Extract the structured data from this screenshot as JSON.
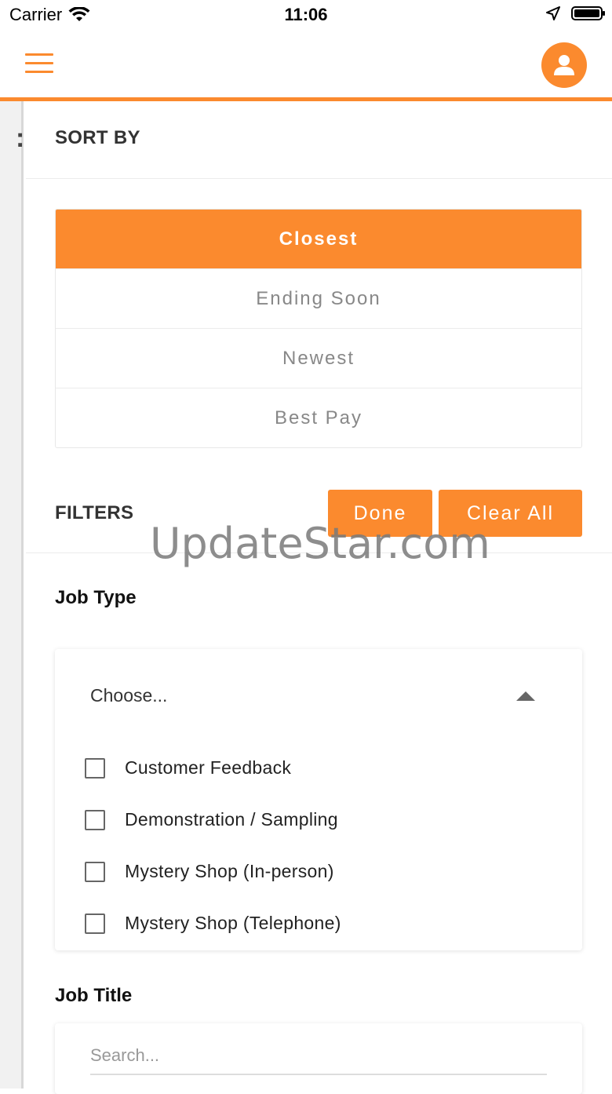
{
  "status_bar": {
    "carrier": "Carrier",
    "time": "11:06"
  },
  "colors": {
    "accent": "#fb8a2e",
    "text_muted": "#888888"
  },
  "header": {
    "menu_icon": "hamburger-menu-icon",
    "profile_icon": "user-profile-icon"
  },
  "sort": {
    "title": "SORT BY",
    "options": [
      "Closest",
      "Ending Soon",
      "Newest",
      "Best Pay"
    ],
    "selected": "Closest"
  },
  "filters": {
    "title": "FILTERS",
    "done_label": "Done",
    "clear_label": "Clear All"
  },
  "watermark": "UpdateStar.com",
  "job_type": {
    "label": "Job Type",
    "placeholder": "Choose...",
    "options": [
      "Customer Feedback",
      "Demonstration / Sampling",
      "Mystery Shop (In-person)",
      "Mystery Shop (Telephone)"
    ]
  },
  "job_title": {
    "label": "Job Title",
    "placeholder": "Search..."
  }
}
